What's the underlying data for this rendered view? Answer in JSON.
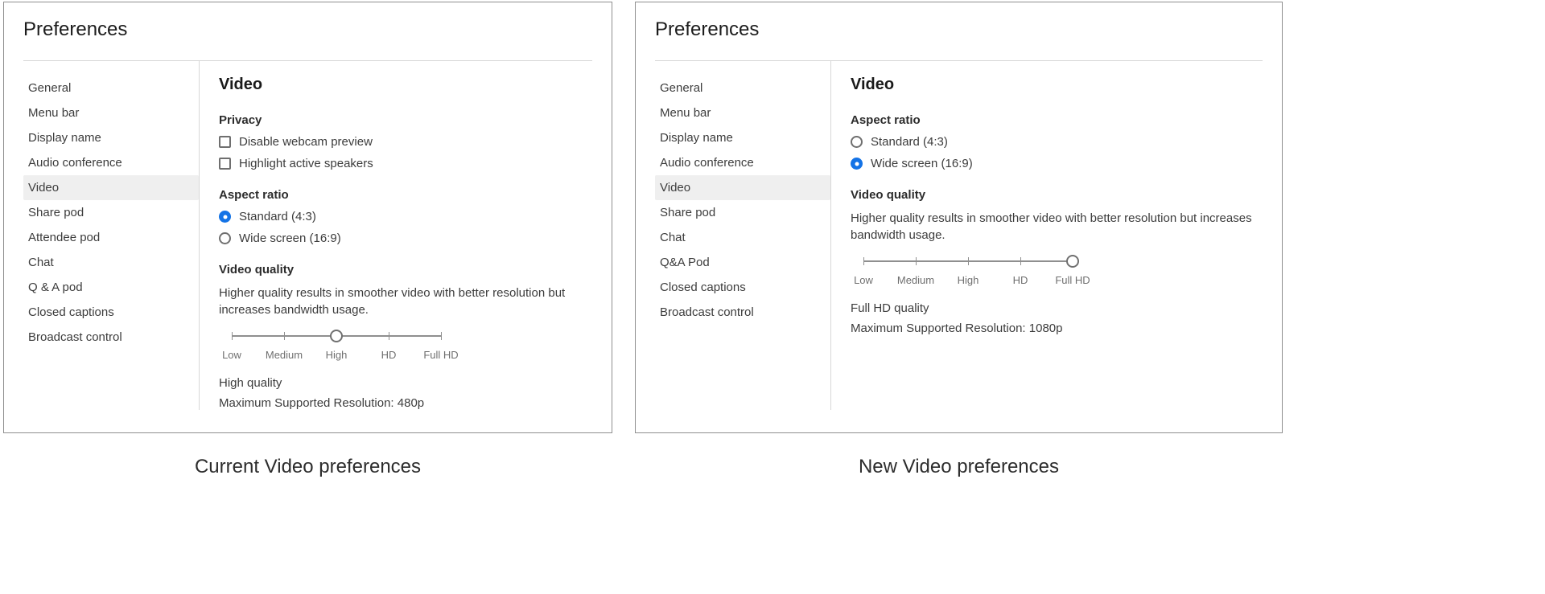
{
  "captions": {
    "left": "Current Video preferences",
    "right": "New Video preferences"
  },
  "left": {
    "title": "Preferences",
    "sidebar": [
      "General",
      "Menu bar",
      "Display name",
      "Audio conference",
      "Video",
      "Share pod",
      "Attendee pod",
      "Chat",
      "Q & A pod",
      "Closed captions",
      "Broadcast control"
    ],
    "selectedIndex": 4,
    "main": {
      "heading": "Video",
      "privacy": {
        "label": "Privacy",
        "items": [
          "Disable webcam preview",
          "Highlight active speakers"
        ]
      },
      "aspect": {
        "label": "Aspect ratio",
        "options": [
          "Standard (4:3)",
          "Wide screen (16:9)"
        ],
        "selected": 0
      },
      "quality": {
        "label": "Video quality",
        "desc": "Higher quality results in smoother video with better resolution but increases bandwidth usage.",
        "stops": [
          "Low",
          "Medium",
          "High",
          "HD",
          "Full HD"
        ],
        "value": 2,
        "current": "High quality",
        "res": "Maximum Supported Resolution: 480p"
      }
    }
  },
  "right": {
    "title": "Preferences",
    "sidebar": [
      "General",
      "Menu bar",
      "Display name",
      "Audio conference",
      "Video",
      "Share pod",
      "Chat",
      "Q&A Pod",
      "Closed captions",
      "Broadcast control"
    ],
    "selectedIndex": 4,
    "main": {
      "heading": "Video",
      "aspect": {
        "label": "Aspect ratio",
        "options": [
          "Standard (4:3)",
          "Wide screen (16:9)"
        ],
        "selected": 1
      },
      "quality": {
        "label": "Video quality",
        "desc": "Higher quality results in smoother video with better resolution but increases bandwidth usage.",
        "stops": [
          "Low",
          "Medium",
          "High",
          "HD",
          "Full HD"
        ],
        "value": 4,
        "current": "Full HD quality",
        "res": "Maximum Supported Resolution: 1080p"
      }
    }
  }
}
